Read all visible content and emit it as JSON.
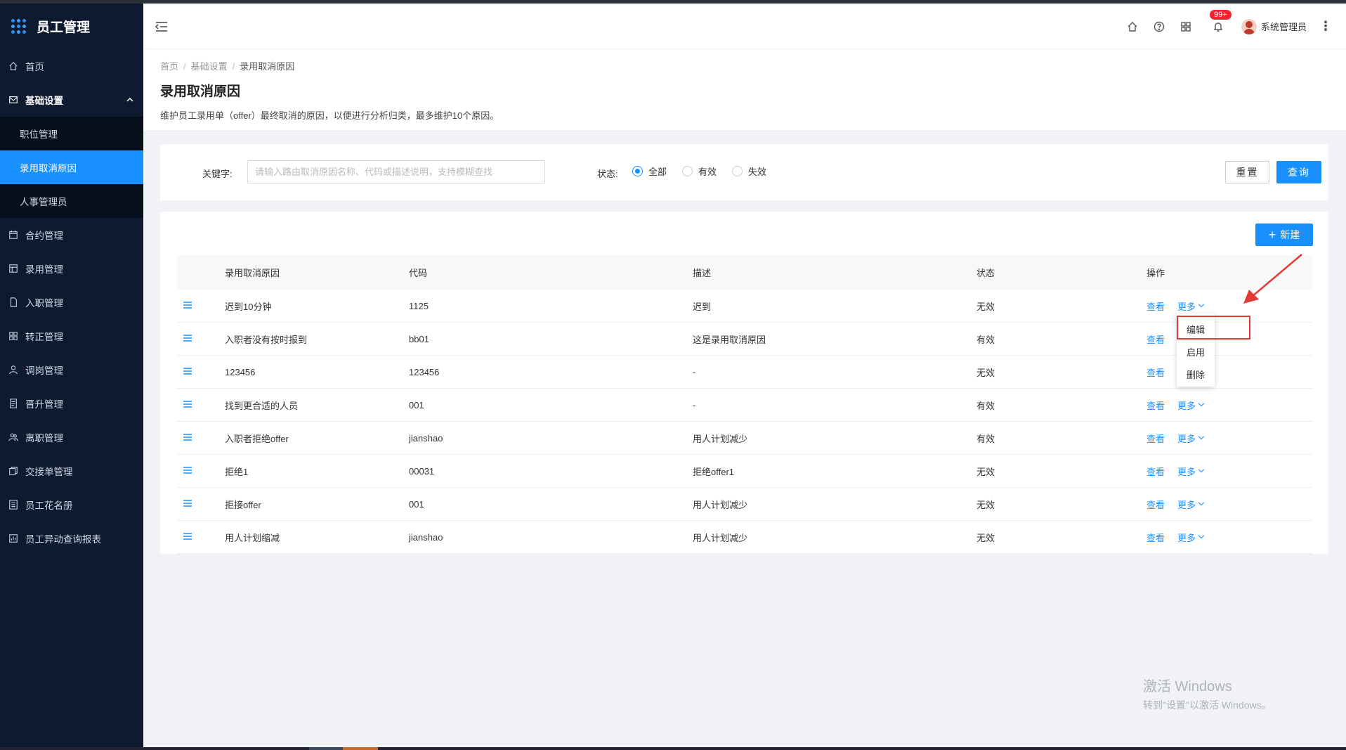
{
  "app": {
    "title": "员工管理"
  },
  "sidebar": {
    "items": [
      {
        "label": "首页",
        "icon": "home-icon"
      },
      {
        "label": "基础设置",
        "icon": "mail-icon",
        "expanded": true,
        "children": [
          {
            "label": "职位管理",
            "active": false
          },
          {
            "label": "录用取消原因",
            "active": true
          },
          {
            "label": "人事管理员",
            "active": false
          }
        ]
      },
      {
        "label": "合约管理",
        "icon": "calendar-icon"
      },
      {
        "label": "录用管理",
        "icon": "layout-icon"
      },
      {
        "label": "入职管理",
        "icon": "file-icon"
      },
      {
        "label": "转正管理",
        "icon": "grid-icon"
      },
      {
        "label": "调岗管理",
        "icon": "user-icon"
      },
      {
        "label": "晋升管理",
        "icon": "document-icon"
      },
      {
        "label": "离职管理",
        "icon": "users-icon"
      },
      {
        "label": "交接单管理",
        "icon": "copy-icon"
      },
      {
        "label": "员工花名册",
        "icon": "list-icon"
      },
      {
        "label": "员工异动查询报表",
        "icon": "report-icon"
      }
    ]
  },
  "header": {
    "notification_badge": "99+",
    "user_name": "系统管理员"
  },
  "page": {
    "breadcrumb": [
      "首页",
      "基础设置",
      "录用取消原因"
    ],
    "title": "录用取消原因",
    "description": "维护员工录用单（offer）最终取消的原因，以便进行分析归类，最多维护10个原因。"
  },
  "filter": {
    "keyword_label": "关键字:",
    "keyword_placeholder": "请输入路由取消原因名称、代码或描述说明，支持模糊查找",
    "keyword_value": "",
    "status_label": "状态:",
    "status_options": [
      "全部",
      "有效",
      "失效"
    ],
    "status_selected": "全部",
    "reset_label": "重置",
    "query_label": "查询"
  },
  "table": {
    "new_button": "新建",
    "columns": [
      "录用取消原因",
      "代码",
      "描述",
      "状态",
      "操作"
    ],
    "rows": [
      {
        "reason": "迟到10分钟",
        "code": "1125",
        "desc": "迟到",
        "status": "无效",
        "view": "查看",
        "more": "更多"
      },
      {
        "reason": "入职者没有按时报到",
        "code": "bb01",
        "desc": "这是录用取消原因",
        "status": "有效",
        "view": "查看",
        "more": ""
      },
      {
        "reason": "123456",
        "code": "123456",
        "desc": "-",
        "status": "无效",
        "view": "查看",
        "more": ""
      },
      {
        "reason": "找到更合适的人员",
        "code": "001",
        "desc": "-",
        "status": "有效",
        "view": "查看",
        "more": "更多"
      },
      {
        "reason": "入职者拒绝offer",
        "code": "jianshao",
        "desc": "用人计划减少",
        "status": "有效",
        "view": "查看",
        "more": "更多"
      },
      {
        "reason": "拒绝1",
        "code": "00031",
        "desc": "拒绝offer1",
        "status": "无效",
        "view": "查看",
        "more": "更多"
      },
      {
        "reason": "拒接offer",
        "code": "001",
        "desc": "用人计划减少",
        "status": "无效",
        "view": "查看",
        "more": "更多"
      },
      {
        "reason": "用人计划缩减",
        "code": "jianshao",
        "desc": "用人计划减少",
        "status": "无效",
        "view": "查看",
        "more": "更多"
      }
    ]
  },
  "dropdown": {
    "items": [
      "编辑",
      "启用",
      "删除"
    ],
    "highlighted": "编辑"
  },
  "watermark": {
    "line1": "激活 Windows",
    "line2": "转到\"设置\"以激活 Windows。"
  },
  "colors": {
    "primary": "#1890ff",
    "sidebar_bg": "#0e1a2f",
    "highlight": "#e53935"
  }
}
